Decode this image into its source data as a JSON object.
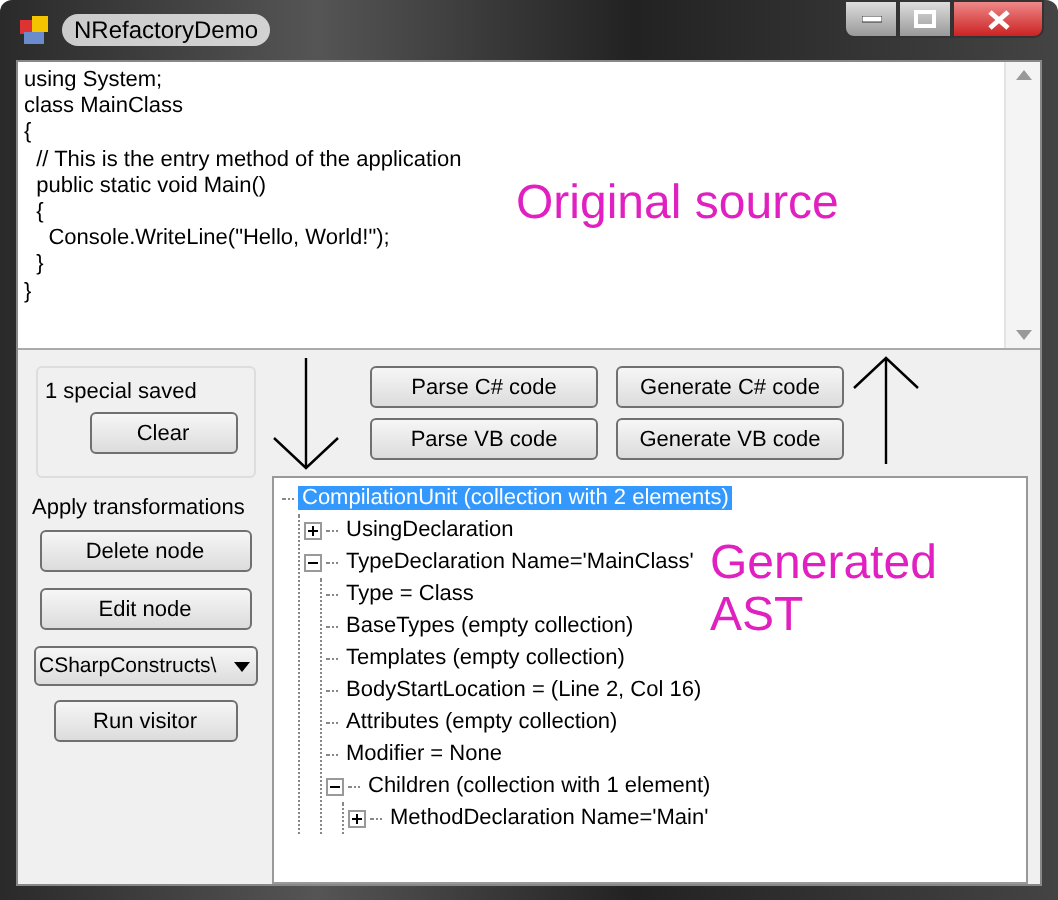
{
  "window": {
    "title": "NRefactoryDemo"
  },
  "code_editor": {
    "lines": [
      "using System;",
      "class MainClass",
      "{",
      "  // This is the entry method of the application",
      "  public static void Main()",
      "  {",
      "    Console.WriteLine(\"Hello, World!\");",
      "  }",
      "}"
    ],
    "annotation": "Original source"
  },
  "saved_group": {
    "status": "1 special saved",
    "button": "Clear"
  },
  "transformations": {
    "label": "Apply transformations",
    "buttons": [
      "Delete node",
      "Edit node"
    ],
    "combo": {
      "value": "CSharpConstructs\\"
    },
    "run_button": "Run visitor"
  },
  "actions": [
    "Parse C# code",
    "Generate C# code",
    "Parse VB code",
    "Generate VB code"
  ],
  "tree": {
    "annotation": [
      "Generated",
      "AST"
    ],
    "nodes": [
      {
        "label": "CompilationUnit (collection with 2 elements)",
        "selected": true,
        "children": [
          {
            "label": "UsingDeclaration",
            "selected": false,
            "expanded": false
          },
          {
            "label": "TypeDeclaration Name='MainClass'",
            "selected": false,
            "expanded": true,
            "children": [
              {
                "label": "Type = Class",
                "selected": false
              },
              {
                "label": "BaseTypes (empty collection)",
                "selected": false
              },
              {
                "label": "Templates (empty collection)",
                "selected": false
              },
              {
                "label": "BodyStartLocation = (Line 2, Col 16)",
                "selected": false
              },
              {
                "label": "Attributes (empty collection)",
                "selected": false
              },
              {
                "label": "Modifier = None",
                "selected": false
              },
              {
                "label": "Children (collection with 1 element)",
                "selected": false,
                "expanded": true,
                "children": [
                  {
                    "label": "MethodDeclaration Name='Main'",
                    "selected": false,
                    "expanded": false
                  }
                ]
              }
            ]
          }
        ]
      }
    ]
  }
}
